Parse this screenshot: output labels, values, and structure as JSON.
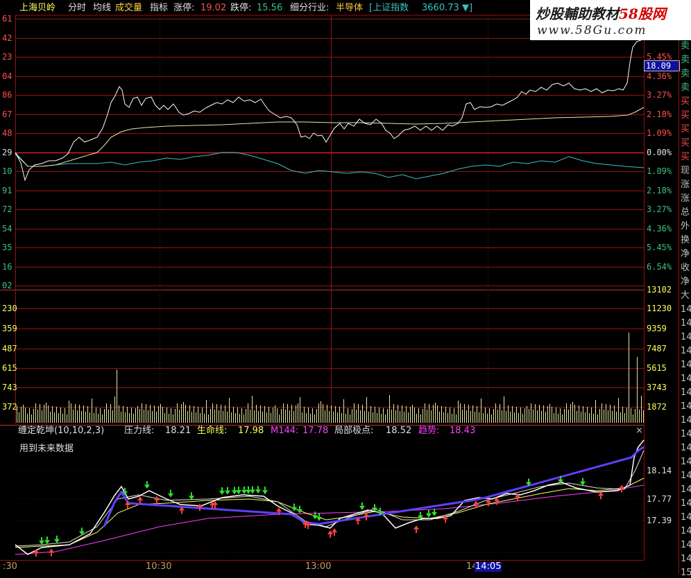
{
  "header": {
    "stock_name": "上海贝岭",
    "tabs": [
      "分时",
      "均线",
      "成交量",
      "指标"
    ],
    "limit_up_label": "涨停:",
    "limit_up_value": "19.02",
    "limit_down_label": "跌停:",
    "limit_down_value": "15.56",
    "industry_label": "细分行业:",
    "industry_value": "半导体",
    "index_name": "[上证指数",
    "index_value": "3660.73",
    "index_arrow": "▼]"
  },
  "watermark": {
    "line1_a": "炒股輔助教材",
    "line1_b": "58股网",
    "line2": "www.58Gu.com"
  },
  "price_panel": {
    "left_labels": [
      "61",
      "42",
      "23",
      "04",
      "86",
      "67",
      "48",
      "29",
      "10",
      "91",
      "72",
      "54",
      "35",
      "16",
      "02"
    ],
    "right_labels": [
      "",
      "5.45%",
      "4.36%",
      "3.27%",
      "2.18%",
      "1.09%",
      "0.00%",
      "1.09%",
      "2.18%",
      "3.27%",
      "4.36%",
      "5.45%",
      "6.54%"
    ],
    "current_price": "18.09"
  },
  "volume_panel": {
    "left_labels": [
      "230",
      "359",
      "487",
      "615",
      "743",
      "372"
    ],
    "right_labels": [
      "13102",
      "11230",
      "9359",
      "7487",
      "5615",
      "3743",
      "1872"
    ]
  },
  "indicator_panel": {
    "title": "缠定乾坤(10,10,2,3)",
    "items": [
      {
        "label": "压力线:",
        "value": "18.21",
        "color": "#e0e0e0"
      },
      {
        "label": "生命线:",
        "value": "17.98",
        "color": "#ffff60"
      },
      {
        "label": "M144:",
        "value": "17.78",
        "color": "#ff40ff"
      },
      {
        "label": "局部极点:",
        "value": "18.52",
        "color": "#e0e0e0"
      },
      {
        "label": "趋势:",
        "value": "18.43",
        "color": "#ff40ff"
      }
    ],
    "note": "用到未来数据",
    "close_symbol": "×",
    "right_labels": [
      "18.14",
      "17.77",
      "17.39"
    ]
  },
  "time_axis": {
    "labels": [
      ":30",
      "10:30",
      "13:00",
      "14",
      "14:05"
    ]
  },
  "side_panel": {
    "labels": [
      "卖",
      "卖",
      "卖",
      "卖",
      "买",
      "买",
      "买",
      "买",
      "买",
      "现",
      "涨",
      "涨",
      "总",
      "外",
      "换",
      "净",
      "收",
      "净",
      "大",
      "14",
      "14",
      "14",
      "14",
      "14",
      "14",
      "14",
      "14",
      "14",
      "14",
      "14",
      "14",
      "14",
      "14",
      "14",
      "14",
      "14",
      "14",
      "14",
      "15"
    ]
  },
  "colors": {
    "grid": "#9a1010",
    "price": "#ffffff",
    "avg": "#e8e8a0",
    "index": "#40c0c0",
    "up_text": "#ff5050",
    "down_text": "#40c080"
  }
}
